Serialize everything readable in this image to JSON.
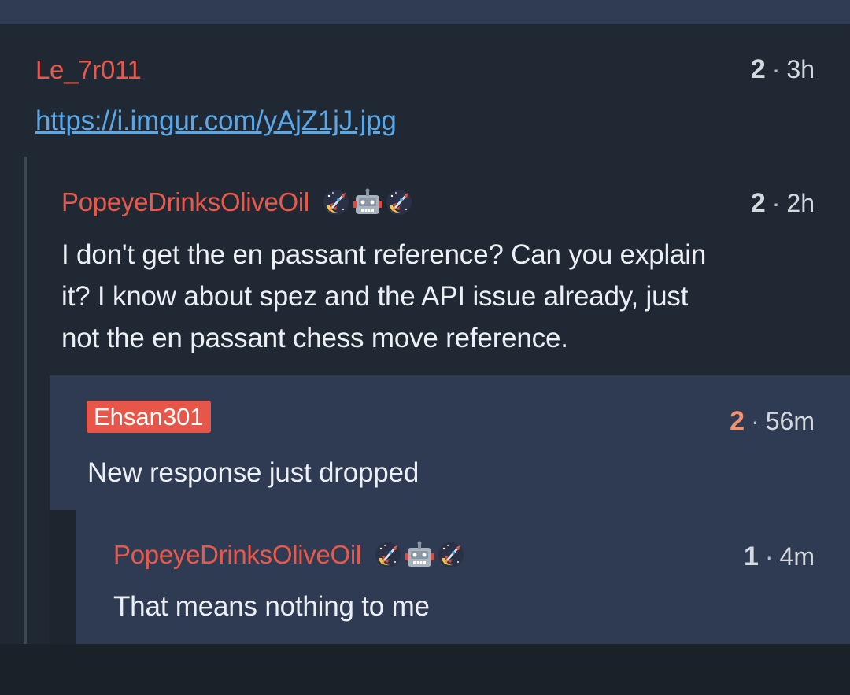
{
  "comments": [
    {
      "author": "Le_7r011",
      "score": "2",
      "separator": "·",
      "age": "3h",
      "link": "https://i.imgur.com/yAjZ1jJ.jpg"
    },
    {
      "author": "PopeyeDrinksOliveOil",
      "flair_icons": [
        "rocket-moon-icon",
        "robot-icon",
        "rocket-moon-icon"
      ],
      "score": "2",
      "separator": "·",
      "age": "2h",
      "text_lines": [
        "I don't get the en passant reference? Can you explain",
        "it? I know about spez and the API issue already, just",
        "not the en passant chess move reference."
      ]
    },
    {
      "author": "Ehsan301",
      "score": "2",
      "separator": "·",
      "age": "56m",
      "text": "New response just dropped"
    },
    {
      "author": "PopeyeDrinksOliveOil",
      "flair_icons": [
        "rocket-moon-icon",
        "robot-icon",
        "rocket-moon-icon"
      ],
      "score": "1",
      "separator": "·",
      "age": "4m",
      "text": "That means nothing to me"
    }
  ],
  "colors": {
    "background": "#202933",
    "highlight_background": "#2f3b52",
    "username_red": "#e8594c",
    "op_badge": "#e6574a",
    "link_blue": "#5ba8e8",
    "upvoted_score": "#f0926f"
  }
}
